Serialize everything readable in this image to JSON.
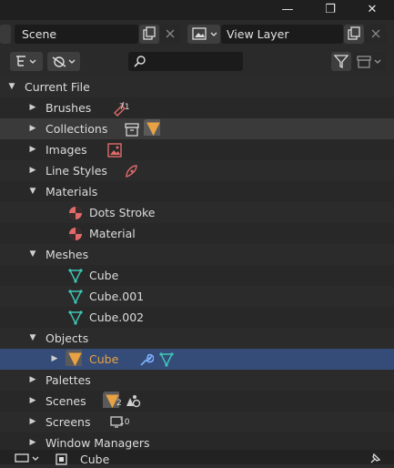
{
  "scene": {
    "label": "Scene"
  },
  "view_layer": {
    "label": "View Layer"
  },
  "tree": {
    "root": "Current File",
    "brushes": {
      "label": "Brushes",
      "count": "71"
    },
    "collections": "Collections",
    "images": "Images",
    "line_styles": "Line Styles",
    "materials": {
      "label": "Materials",
      "children": [
        "Dots Stroke",
        "Material"
      ]
    },
    "meshes": {
      "label": "Meshes",
      "children": [
        "Cube",
        "Cube.001",
        "Cube.002"
      ]
    },
    "objects": {
      "label": "Objects",
      "child": "Cube"
    },
    "palettes": "Palettes",
    "scenes": {
      "label": "Scenes",
      "count": "2"
    },
    "screens": {
      "label": "Screens",
      "count": "10"
    },
    "window_managers": "Window Managers"
  },
  "footer": {
    "object": "Cube"
  },
  "colors": {
    "accent": "#e8a244",
    "selected_row": "#354c78",
    "material": "#e06a6a",
    "mesh": "#3ec5b6"
  }
}
